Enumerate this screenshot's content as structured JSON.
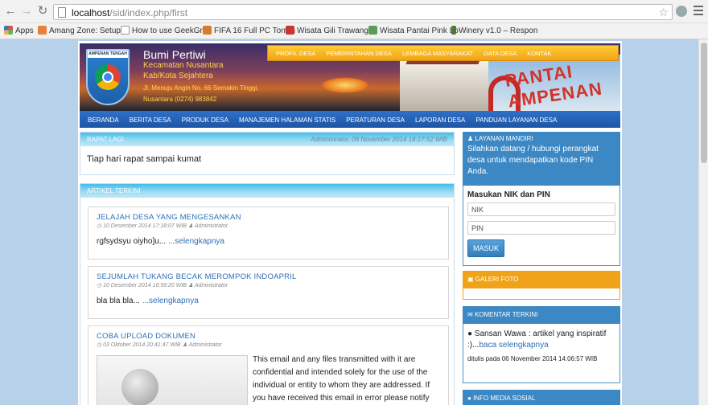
{
  "browser": {
    "url_host": "localhost",
    "url_path": "/sid/index.php/first",
    "bookmarks": [
      {
        "label": "Apps",
        "color": "#d9534f"
      },
      {
        "label": "Amang Zone: Setup C",
        "color": "#e8803a"
      },
      {
        "label": "How to use GeekGrad",
        "color": "#888888"
      },
      {
        "label": "FIFA 16 Full PC Torren",
        "color": "#d87a2a"
      },
      {
        "label": "Wisata Gili Trawangan",
        "color": "#cc3333"
      },
      {
        "label": "Wisata Pantai Pink Lo",
        "color": "#5a9a5a"
      },
      {
        "label": "Winery v1.0 – Respon",
        "color": "#4a7a3a"
      }
    ]
  },
  "header": {
    "badge_text": "AMPENAN TENGAH",
    "site_name": "Bumi Pertiwi",
    "line1": "Kecamatan Nusantara",
    "line2": "Kab/Kota Sejahtera",
    "address": "Jl. Menuju Angin No. 66 Semakin Tinggi,",
    "address2": "Nusantara (0274) 983842",
    "arch_text": "PANTAI AMPENAN",
    "topnav": [
      "PROFIL DESA",
      "PEMERINTAHAN DESA",
      "LEMBAGA MASYARAKAT",
      "DATA DESA",
      "KONTAK"
    ],
    "mainnav": [
      "BERANDA",
      "BERITA DESA",
      "PRODUK DESA",
      "MANAJEMEN HALAMAN STATIS",
      "PERATURAN DESA",
      "LAPORAN DESA",
      "PANDUAN LAYANAN DESA"
    ]
  },
  "announcement": {
    "title": "RAPAT LAGI",
    "meta": "Administrator, 06 November 2014 18:17:52 WIB",
    "text": "Tiap hari rapat sampai kumat"
  },
  "articles_section": {
    "title": "ARTIKEL TERKINI",
    "items": [
      {
        "title": "JELAJAH DESA YANG MENGESANKAN",
        "date": "10 Desember 2014 17:18:07 WIB",
        "author": "Administrator",
        "body": "rgfsydsyu oiyho]u... ",
        "more": "...selengkapnya"
      },
      {
        "title": "SEJUMLAH TUKANG BECAK MEROMPOK INDOAPRIL",
        "date": "10 Desember 2014 16:59:20 WIB",
        "author": "Administrator",
        "body": "bla bla bla... ",
        "more": "...selengkapnya"
      },
      {
        "title": "COBA UPLOAD DOKUMEN",
        "date": "03 Oktober 2014 20:41:47 WIB",
        "author": "Administrator",
        "body": "This email and any files transmitted with it are confidential and intended solely for the use of the individual or entity to whom they are addressed. If you have received this email in error please notify"
      }
    ]
  },
  "sidebar": {
    "layanan": {
      "title": "LAYANAN MANDIRI",
      "desc": "Silahkan datang / hubungi perangkat desa untuk mendapatkan kode PIN Anda.",
      "form_label": "Masukan NIK dan PIN",
      "nik_placeholder": "NIK",
      "pin_placeholder": "PIN",
      "submit": "MASUK"
    },
    "galeri": {
      "title": "GALERI FOTO"
    },
    "komentar": {
      "title": "KOMENTAR TERKINI",
      "author": "Sansan Wawa",
      "text": " : artikel yang inspiratif :)...",
      "more": "baca selengkapnya",
      "date": "ditulis pada 06 November 2014 14:06:57 WIB"
    },
    "media": {
      "title": "INFO MEDIA SOSIAL"
    }
  }
}
